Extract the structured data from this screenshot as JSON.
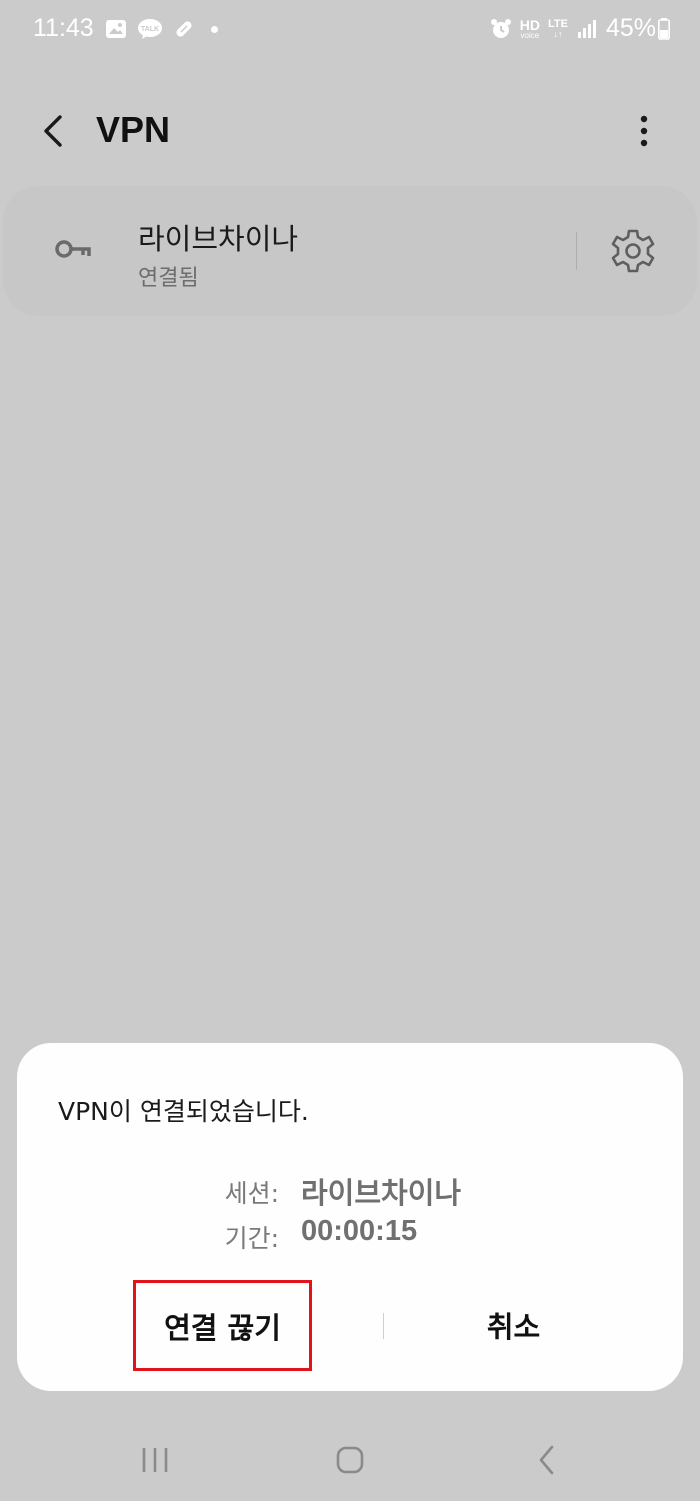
{
  "status_bar": {
    "time": "11:43",
    "left_icons": [
      "gallery-icon",
      "talk-icon",
      "pill-icon"
    ],
    "hd_label": "HD",
    "voice_label": "voice",
    "lte_label": "LTE",
    "battery": "45%"
  },
  "header": {
    "title": "VPN"
  },
  "vpn_profile": {
    "name": "라이브차이나",
    "status": "연결됨"
  },
  "dialog": {
    "title": "VPN이 연결되었습니다.",
    "session_label": "세션:",
    "session_value": "라이브차이나",
    "duration_label": "기간:",
    "duration_value": "00:00:15",
    "disconnect_label": "연결 끊기",
    "cancel_label": "취소",
    "highlight_color": "#e0141a"
  },
  "nav_bar": {
    "buttons": [
      "recent-apps-icon",
      "home-icon",
      "back-icon"
    ]
  }
}
